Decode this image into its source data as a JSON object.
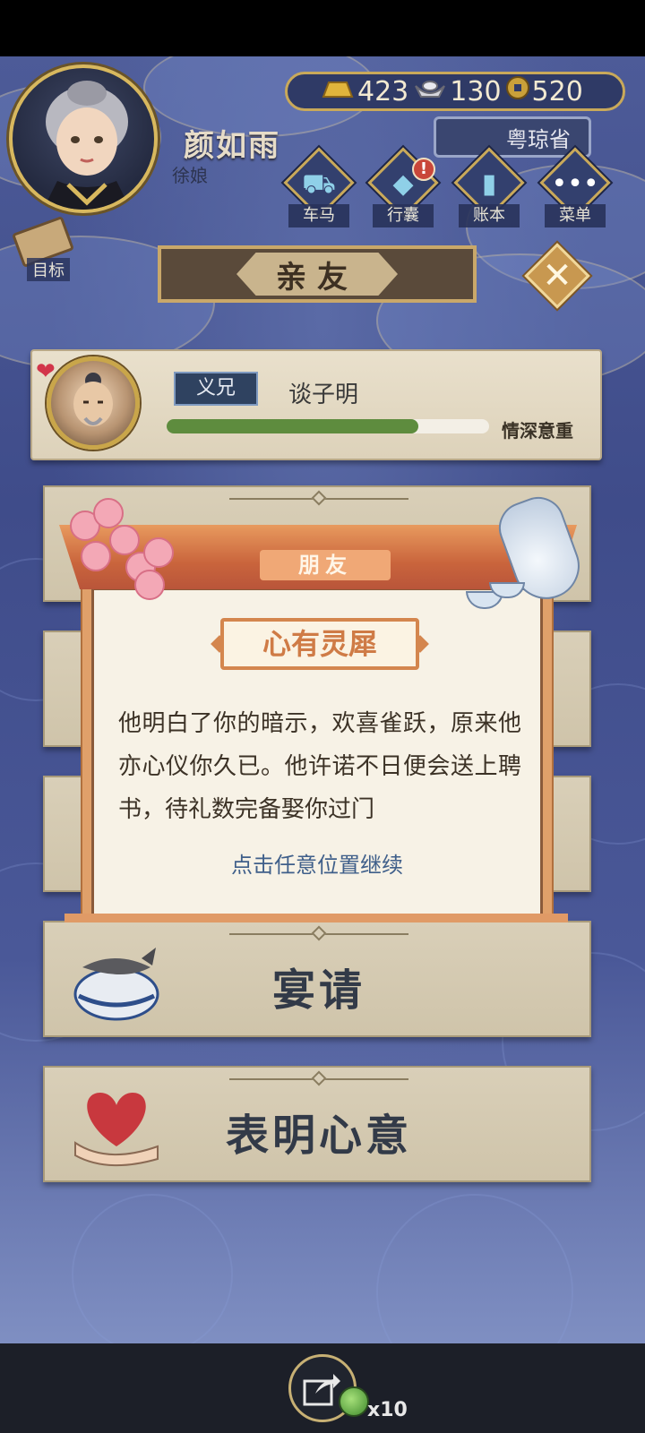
{
  "player": {
    "name": "颜如雨",
    "title": "徐娘"
  },
  "currency": {
    "gold": "423",
    "silver": "130",
    "coin": "520"
  },
  "province": "粤琼省",
  "menu": {
    "carriage": "车马",
    "bag": "行囊",
    "ledger": "账本",
    "menu": "菜单"
  },
  "alert_mark": "!",
  "target_label": "目标",
  "page_title": "亲友",
  "close_symbol": "✕",
  "friend": {
    "relation": "义兄",
    "name": "谈子明",
    "bond_label": "情深意重",
    "bond_level": 0.78
  },
  "actions": {
    "banquet": "宴请",
    "confess": "表明心意"
  },
  "modal": {
    "tag": "朋友",
    "title": "心有灵犀",
    "message": "他明白了你的暗示，欢喜雀跃，原来他亦心仪你久已。他许诺不日便会送上聘书，待礼数完备娶你过门",
    "hint": "点击任意位置继续"
  },
  "bottom": {
    "share_count": "x10"
  },
  "colors": {
    "accent_gold": "#c9a95a",
    "bond_fill": "#5e8c3e",
    "modal_orange": "#d4864e",
    "hint_blue": "#3f5f8a"
  }
}
